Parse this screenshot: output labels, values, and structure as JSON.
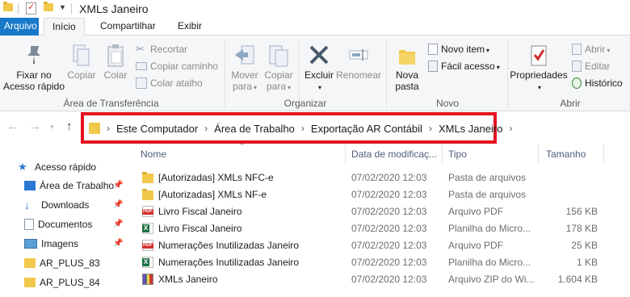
{
  "window": {
    "title": "XMLs Janeiro"
  },
  "ribbon_tabs": [
    "Arquivo",
    "Início",
    "Compartilhar",
    "Exibir"
  ],
  "ribbon": {
    "clipboard": {
      "group_label": "Área de Transferência",
      "pin_label_1": "Fixar no",
      "pin_label_2": "Acesso rápido",
      "copy": "Copiar",
      "paste": "Colar",
      "cut": "Recortar",
      "copy_path": "Copiar caminho",
      "paste_shortcut": "Colar atalho"
    },
    "organize": {
      "group_label": "Organizar",
      "move_1": "Mover",
      "move_2": "para",
      "copy_1": "Copiar",
      "copy_2": "para",
      "delete": "Excluir",
      "rename": "Renomear"
    },
    "new": {
      "group_label": "Novo",
      "new_folder_1": "Nova",
      "new_folder_2": "pasta",
      "new_item": "Novo item",
      "easy_access": "Fácil acesso"
    },
    "open": {
      "group_label": "Abrir",
      "properties": "Propriedades",
      "open": "Abrir",
      "edit": "Editar",
      "history": "Histórico"
    }
  },
  "address_bar": {
    "crumbs": [
      "Este Computador",
      "Área de Trabalho",
      "Exportação AR Contábil",
      "XMLs Janeiro"
    ],
    "highlight_color": "#e3141f"
  },
  "sidebar": {
    "items": [
      {
        "label": "Acesso rápido",
        "icon": "star-icon",
        "pinned": false
      },
      {
        "label": "Área de Trabalho",
        "icon": "desktop-folder-icon",
        "pinned": true
      },
      {
        "label": "Downloads",
        "icon": "download-arrow-icon",
        "pinned": true
      },
      {
        "label": "Documentos",
        "icon": "documents-icon",
        "pinned": true
      },
      {
        "label": "Imagens",
        "icon": "pictures-icon",
        "pinned": true
      },
      {
        "label": "AR_PLUS_83",
        "icon": "folder-icon",
        "pinned": false
      },
      {
        "label": "AR_PLUS_84",
        "icon": "folder-icon",
        "pinned": false
      }
    ]
  },
  "file_list": {
    "columns": [
      "Nome",
      "Data de modificaç...",
      "Tipo",
      "Tamanho"
    ],
    "rows": [
      {
        "name": "[Autorizadas] XMLs NFC-e",
        "date": "07/02/2020 12:03",
        "type": "Pasta de arquivos",
        "size": "",
        "icon": "folder"
      },
      {
        "name": "[Autorizadas] XMLs NF-e",
        "date": "07/02/2020 12:03",
        "type": "Pasta de arquivos",
        "size": "",
        "icon": "folder"
      },
      {
        "name": "Livro Fiscal Janeiro",
        "date": "07/02/2020 12:03",
        "type": "Arquivo PDF",
        "size": "156 KB",
        "icon": "pdf"
      },
      {
        "name": "Livro Fiscal Janeiro",
        "date": "07/02/2020 12:03",
        "type": "Planilha do Micro...",
        "size": "178 KB",
        "icon": "xls"
      },
      {
        "name": "Numerações Inutilizadas Janeiro",
        "date": "07/02/2020 12:03",
        "type": "Arquivo PDF",
        "size": "25 KB",
        "icon": "pdf"
      },
      {
        "name": "Numerações Inutilizadas Janeiro",
        "date": "07/02/2020 12:03",
        "type": "Planilha do Micro...",
        "size": "1 KB",
        "icon": "xls"
      },
      {
        "name": "XMLs Janeiro",
        "date": "07/02/2020 12:03",
        "type": "Arquivo ZIP do Wi...",
        "size": "1.604 KB",
        "icon": "zip"
      }
    ]
  }
}
